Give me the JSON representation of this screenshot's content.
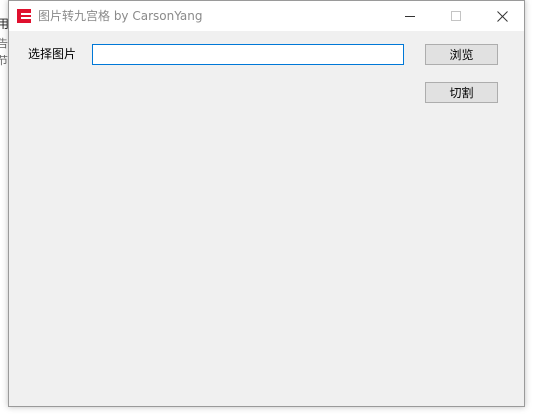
{
  "background_window": {
    "snippets": [
      "用",
      "告",
      "节"
    ]
  },
  "window": {
    "title": "图片转九宫格 by CarsonYang",
    "icon": "app-logo-icon",
    "controls": {
      "minimize": "minimize-icon",
      "maximize": "maximize-icon",
      "close": "close-icon"
    }
  },
  "form": {
    "select_label": "选择图片",
    "path_value": "",
    "browse_label": "浏览",
    "cut_label": "切割"
  },
  "colors": {
    "accent": "#0078d7",
    "icon_red": "#e0102e",
    "window_bg": "#f0f0f0",
    "button_bg": "#e1e1e1"
  }
}
